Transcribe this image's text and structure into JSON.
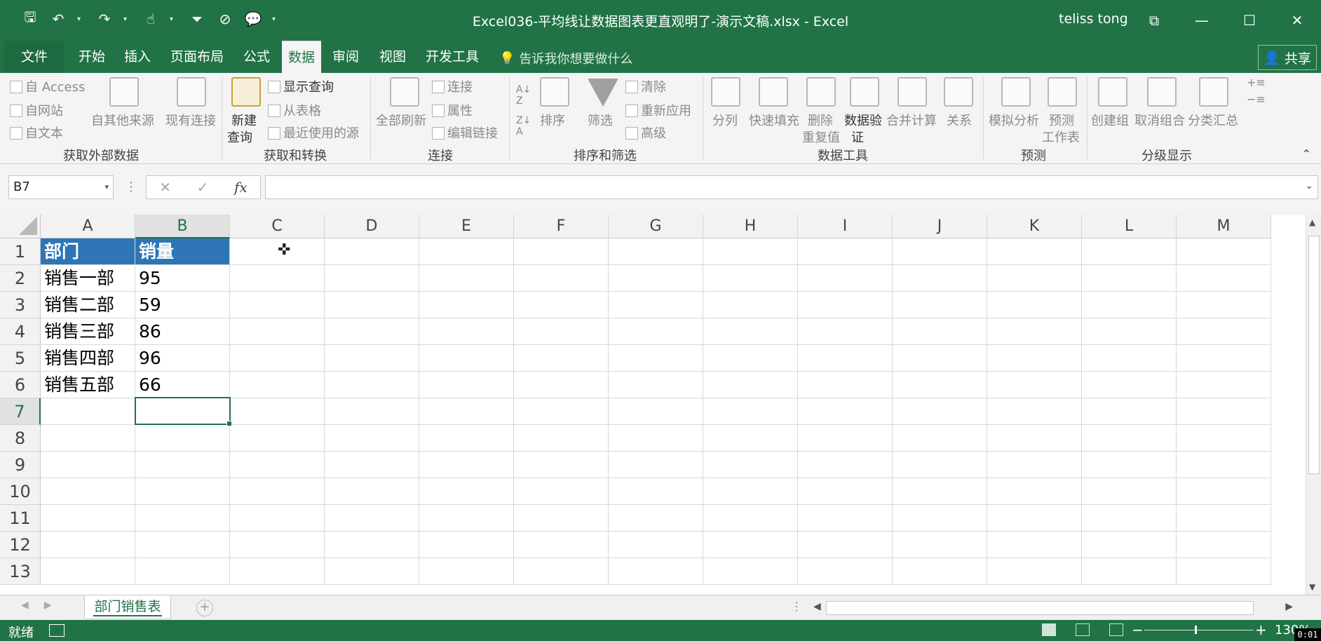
{
  "window": {
    "title": "Excel036-平均线让数据图表更直观明了-演示文稿.xlsx  -  Excel",
    "user": "teliss tong",
    "share": "共享"
  },
  "qat": {
    "icons": [
      "save-icon",
      "undo-icon",
      "redo-icon",
      "touch-mode-icon",
      "filter-icon",
      "clear-filter-icon",
      "comment-icon",
      "customize-icon"
    ]
  },
  "tabs": [
    {
      "label": "文件"
    },
    {
      "label": "开始"
    },
    {
      "label": "插入"
    },
    {
      "label": "页面布局"
    },
    {
      "label": "公式"
    },
    {
      "label": "数据"
    },
    {
      "label": "审阅"
    },
    {
      "label": "视图"
    },
    {
      "label": "开发工具"
    }
  ],
  "tellme": "告诉我你想要做什么",
  "ribbon": {
    "external": {
      "access": "自 Access",
      "web": "自网站",
      "text": "自文本",
      "other": "自其他来源",
      "existing": "现有连接",
      "group": "获取外部数据"
    },
    "transform": {
      "newquery_line1": "新建",
      "newquery_line2": "查询",
      "show": "显示查询",
      "fromtable": "从表格",
      "recent": "最近使用的源",
      "group": "获取和转换"
    },
    "connections": {
      "refresh": "全部刷新",
      "conn": "连接",
      "props": "属性",
      "edit": "编辑链接",
      "group": "连接"
    },
    "sortfilter": {
      "sort": "排序",
      "filter": "筛选",
      "clear": "清除",
      "reapply": "重新应用",
      "advanced": "高级",
      "group": "排序和筛选"
    },
    "datatools": {
      "split": "分列",
      "flash": "快速填充",
      "dedupe_line1": "删除",
      "dedupe_line2": "重复值",
      "validate_line1": "数据验",
      "validate_line2": "证",
      "consolidate": "合并计算",
      "relations": "关系",
      "group": "数据工具"
    },
    "forecast": {
      "whatif": "模拟分析",
      "sheet_line1": "预测",
      "sheet_line2": "工作表",
      "group": "预测"
    },
    "outline": {
      "group_btn": "创建组",
      "ungroup": "取消组合",
      "subtotal": "分类汇总",
      "group": "分级显示"
    }
  },
  "formula": {
    "namebox": "B7",
    "cancel": "✕",
    "enter": "✓",
    "fx": "fx",
    "value": ""
  },
  "grid": {
    "columns": [
      "A",
      "B",
      "C",
      "D",
      "E",
      "F",
      "G",
      "H",
      "I",
      "J",
      "K",
      "L",
      "M"
    ],
    "rows": [
      {
        "n": "1",
        "a": "部门",
        "b": "销量"
      },
      {
        "n": "2",
        "a": "销售一部",
        "b": "95"
      },
      {
        "n": "3",
        "a": "销售二部",
        "b": "59"
      },
      {
        "n": "4",
        "a": "销售三部",
        "b": "86"
      },
      {
        "n": "5",
        "a": "销售四部",
        "b": "96"
      },
      {
        "n": "6",
        "a": "销售五部",
        "b": "66"
      },
      {
        "n": "7",
        "a": "",
        "b": ""
      },
      {
        "n": "8",
        "a": "",
        "b": ""
      },
      {
        "n": "9",
        "a": "",
        "b": ""
      },
      {
        "n": "10",
        "a": "",
        "b": ""
      },
      {
        "n": "11",
        "a": "",
        "b": ""
      },
      {
        "n": "12",
        "a": "",
        "b": ""
      },
      {
        "n": "13",
        "a": "",
        "b": ""
      }
    ],
    "selected_column": "B",
    "selected_row": "7",
    "header_fill": "#2e75b6"
  },
  "sheets": [
    {
      "label": "部门销售表"
    }
  ],
  "status": {
    "ready": "就绪",
    "zoom": "130%"
  },
  "clock": "0:01",
  "colors": {
    "excel_green": "#217346"
  }
}
